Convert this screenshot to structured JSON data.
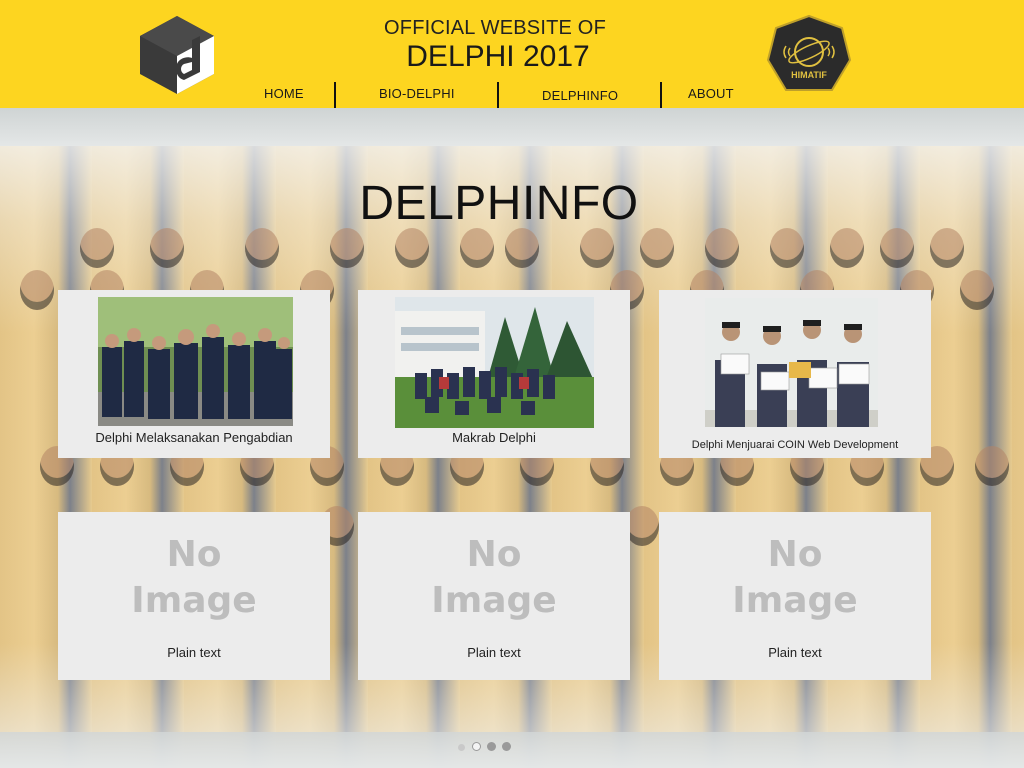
{
  "header": {
    "title_small": "OFFICIAL WEBSITE OF",
    "title_big": "DELPHI 2017",
    "badge_text": "HIMATIF",
    "nav": [
      {
        "label": "HOME"
      },
      {
        "label": "BIO-DELPHI"
      },
      {
        "label": "DELPHINFO"
      },
      {
        "label": "ABOUT"
      }
    ]
  },
  "section": {
    "title": "DELPHINFO"
  },
  "cards": [
    {
      "caption": "Delphi Melaksanakan Pengabdian",
      "image": "group-photo"
    },
    {
      "caption": "Makrab Delphi",
      "image": "group-photo"
    },
    {
      "caption": "Delphi Menjuarai COIN Web Development",
      "image": "award-photo"
    },
    {
      "caption": "Plain text",
      "image": "No Image"
    },
    {
      "caption": "Plain text",
      "image": "No Image"
    },
    {
      "caption": "Plain text",
      "image": "No Image"
    }
  ],
  "no_image": {
    "line1": "No",
    "line2": "Image"
  },
  "colors": {
    "header_bg": "#fdd520",
    "card_bg": "#ececec",
    "text": "#111111"
  },
  "carousel": {
    "count": 3,
    "active": 1
  }
}
